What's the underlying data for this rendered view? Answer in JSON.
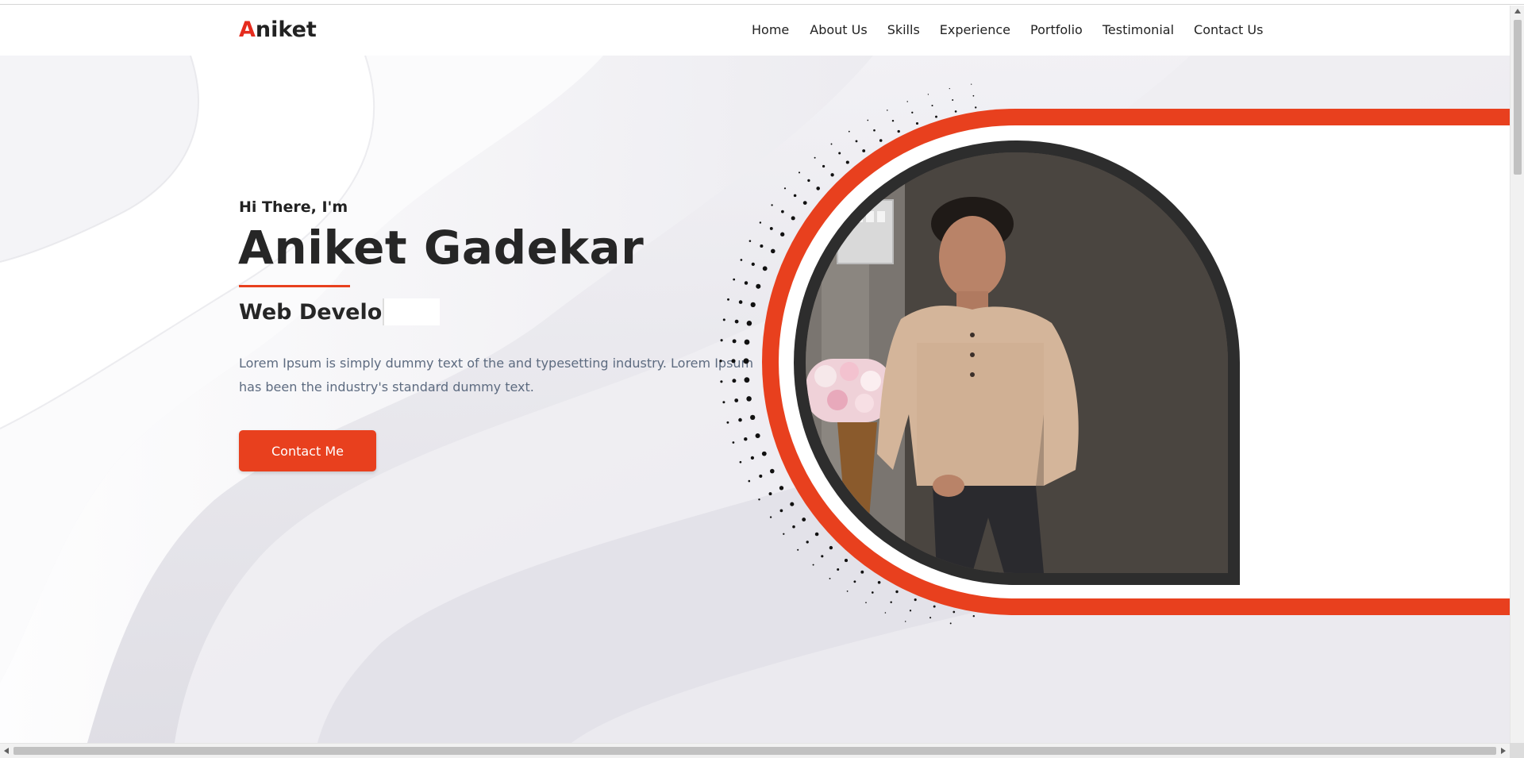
{
  "brand": {
    "first_letter": "A",
    "rest": "niket"
  },
  "nav": {
    "items": [
      {
        "label": "Home"
      },
      {
        "label": "About Us"
      },
      {
        "label": "Skills"
      },
      {
        "label": "Experience"
      },
      {
        "label": "Portfolio"
      },
      {
        "label": "Testimonial"
      },
      {
        "label": "Contact Us"
      }
    ]
  },
  "hero": {
    "greeting": "Hi There, I'm",
    "name": "Aniket Gadekar",
    "role_typed": "Web Develo",
    "description": "Lorem Ipsum is simply dummy text of the and typesetting industry. Lorem Ipsum has been the industry's standard dummy text.",
    "cta_label": "Contact Me"
  },
  "colors": {
    "accent": "#e8401e",
    "brand_accent": "#e52c1e",
    "text_dark": "#262626",
    "text_muted": "#5d6b80",
    "hero_bg": "#e9e8ee"
  },
  "icons": {
    "portrait": "profile-photo",
    "scroll_up": "arrow-up-icon",
    "scroll_left": "arrow-left-icon",
    "scroll_right": "arrow-right-icon"
  }
}
